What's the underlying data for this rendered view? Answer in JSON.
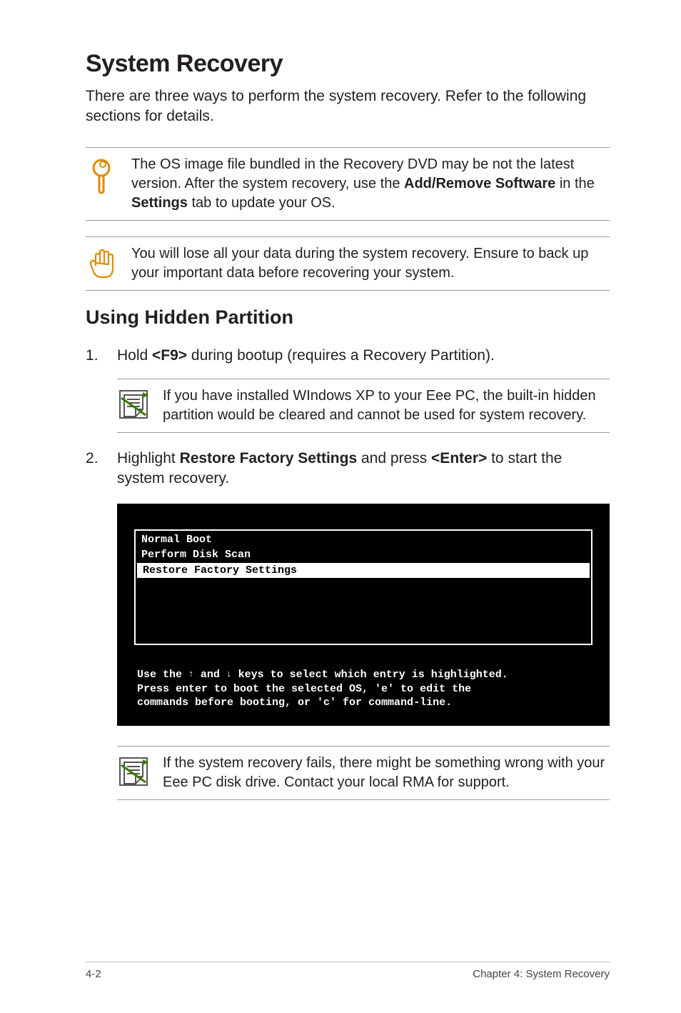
{
  "title": "System Recovery",
  "intro": "There are three ways to perform the system recovery. Refer to the following sections for details.",
  "tip": {
    "pre": "The OS image file bundled in the Recovery DVD may be not the latest version. After the system recovery, use the ",
    "bold1": "Add/Remove Software",
    "mid": " in the ",
    "bold2": "Settings",
    "post": " tab to update your OS."
  },
  "warn": "You will lose all your data during the system recovery. Ensure to back up your important data before recovering your system.",
  "subhead": "Using Hidden Partition",
  "step1": {
    "pre": "Hold ",
    "key": "<F9>",
    "post": " during bootup (requires a Recovery Partition)."
  },
  "note1": "If you have installed WIndows XP to your Eee PC, the built-in hidden partition would be cleared and cannot be used for system recovery.",
  "step2": {
    "pre": "Highlight ",
    "bold1": "Restore Factory Settings",
    "mid": " and press ",
    "bold2": "<Enter>",
    "post": " to start the system recovery."
  },
  "terminal": {
    "line1": "Normal Boot",
    "line2": "Perform Disk Scan",
    "sel": "Restore Factory Settings",
    "help1a": "Use the ",
    "help1b": " and ",
    "help1c": " keys to select which entry is highlighted.",
    "help2": "Press enter to boot the selected OS, 'e' to edit the",
    "help3": "commands before booting, or 'c' for command-line."
  },
  "note2": "If the system recovery fails, there might be something wrong with your Eee PC disk drive. Contact your local RMA for support.",
  "footer": {
    "page": "4-2",
    "chapter": "Chapter 4: System Recovery"
  }
}
